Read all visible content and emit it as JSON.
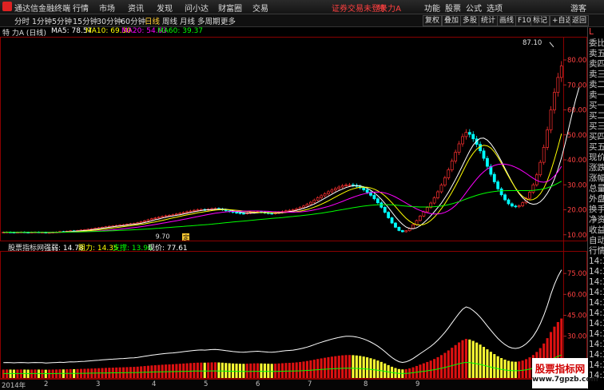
{
  "app": {
    "name": "通达信金融终端"
  },
  "menubar": {
    "items": [
      "行情",
      "市场",
      "资讯",
      "发现",
      "问小达",
      "财富圈",
      "交易"
    ],
    "status": "证券交易未登录",
    "stock_short": "特 力A",
    "right_items": [
      "功能",
      "股票",
      "公式",
      "选项",
      "游客"
    ]
  },
  "toolbar": {
    "timeframes": [
      "分时",
      "1分钟",
      "5分钟",
      "15分钟",
      "30分钟",
      "60分钟",
      "日线",
      "周线",
      "月线",
      "多周期",
      "更多"
    ],
    "active": "日线",
    "buttons": [
      "复权",
      "叠加",
      "多股",
      "统计",
      "画线",
      "F10",
      "标记",
      "+自选",
      "返回"
    ]
  },
  "stock": {
    "title": "特 力A (日线)",
    "ma": [
      {
        "label": "MA5: 78.57",
        "color": "#ffffff"
      },
      {
        "label": "MA10: 69.30",
        "color": "#ffff00"
      },
      {
        "label": "MA20: 54.63",
        "color": "#ff00ff"
      },
      {
        "label": "MA60: 39.37",
        "color": "#00ff00"
      }
    ]
  },
  "indicator": {
    "name": "股票指标网",
    "items": [
      {
        "label": "强弱: 14.78",
        "color": "#ffffff"
      },
      {
        "label": "阻力: 14.35",
        "color": "#ffff00"
      },
      {
        "label": "支撑: 13.96",
        "color": "#00ff00"
      },
      {
        "label": "现价: 77.61",
        "color": "#ffffff"
      }
    ]
  },
  "price_axis": {
    "ticks": [
      "80.00",
      "70.00",
      "60.00",
      "50.00",
      "40.00",
      "30.00",
      "20.00",
      "10.00"
    ],
    "high_label": "87.10",
    "low_label": "9.70",
    "marker": "定"
  },
  "ind_axis": {
    "ticks": [
      "75.00",
      "60.00",
      "45.00",
      "30.00"
    ]
  },
  "side_panel": {
    "top": "L",
    "items": [
      "委比",
      "卖五",
      "卖四",
      "卖三",
      "卖二",
      "卖一",
      "买一",
      "买二",
      "买三",
      "买四",
      "买五",
      "现价",
      "涨跌",
      "涨幅",
      "总量",
      "外盘",
      "换手",
      "净资",
      "收益",
      "自动",
      "行情",
      "14:34",
      "14:35",
      "14:35",
      "14:35",
      "14:35",
      "14:35",
      "14:35",
      "14:35",
      "14:35",
      "14:35",
      "14:35",
      "14:35"
    ]
  },
  "time_axis": {
    "labels": [
      "2014年",
      "2",
      "3",
      "4",
      "5",
      "6",
      "7",
      "8",
      "9"
    ]
  },
  "watermark": {
    "line1": "股票指标网",
    "line2": "www.7gpzb.com"
  },
  "colors": {
    "up": "#ff3030",
    "down": "#00ffff",
    "ma5": "#ffffff",
    "ma10": "#ffff00",
    "ma20": "#ff00ff",
    "ma60": "#00ff00",
    "border": "#8a0000"
  },
  "chart_data": {
    "type": "candlestick",
    "price_ylim": [
      8,
      88
    ],
    "ind_ylim": [
      0,
      90
    ],
    "prices": [
      11.0,
      11.1,
      11.0,
      10.9,
      11.0,
      11.1,
      11.0,
      10.9,
      11.0,
      11.1,
      11.0,
      11.0,
      10.8,
      10.9,
      11.0,
      11.1,
      11.3,
      11.2,
      11.4,
      11.6,
      11.5,
      11.7,
      11.9,
      12.0,
      12.2,
      12.4,
      12.6,
      12.8,
      13.0,
      13.2,
      13.4,
      13.5,
      13.7,
      13.9,
      14.0,
      14.2,
      14.4,
      14.5,
      14.8,
      15.2,
      15.6,
      16.0,
      16.4,
      16.7,
      17.0,
      17.3,
      17.6,
      17.8,
      18.0,
      18.3,
      18.6,
      18.9,
      19.2,
      19.5,
      19.8,
      20.0,
      20.1,
      20.0,
      20.2,
      20.4,
      20.5,
      20.3,
      20.0,
      19.6,
      19.3,
      19.0,
      18.8,
      18.6,
      18.5,
      18.7,
      18.9,
      19.1,
      19.2,
      19.0,
      18.8,
      18.6,
      18.5,
      18.7,
      19.0,
      19.3,
      19.6,
      19.8,
      20.0,
      20.4,
      20.9,
      21.5,
      22.2,
      23.0,
      23.9,
      24.8,
      25.6,
      26.4,
      27.2,
      27.9,
      28.5,
      29.1,
      29.6,
      29.9,
      30.0,
      29.8,
      29.4,
      28.8,
      28.0,
      27.0,
      25.8,
      24.4,
      22.8,
      21.0,
      19.0,
      16.8,
      14.7,
      13.0,
      11.7,
      11.2,
      11.6,
      12.6,
      14.0,
      15.7,
      17.5,
      19.2,
      20.9,
      22.7,
      24.8,
      27.2,
      29.9,
      32.8,
      36.0,
      39.5,
      43.0,
      46.4,
      49.3,
      51.0,
      50.2,
      48.4,
      46.2,
      43.6,
      40.6,
      37.4,
      34.2,
      31.2,
      28.4,
      26.0,
      24.0,
      22.4,
      21.5,
      21.2,
      21.6,
      22.8,
      24.6,
      27.0,
      30.0,
      34.0,
      39.0,
      45.0,
      52.0,
      60.0,
      67.0,
      73.0,
      77.6
    ],
    "high_value": 87.1,
    "low_value": 9.7,
    "ma5": [
      11.0,
      11.0,
      11.0,
      11.0,
      11.0,
      11.0,
      11.0,
      11.0,
      11.0,
      11.0,
      11.0,
      11.0,
      10.9,
      10.9,
      10.9,
      11.0,
      11.0,
      11.1,
      11.2,
      11.3,
      11.4,
      11.5,
      11.6,
      11.7,
      11.8,
      12.0,
      12.2,
      12.4,
      12.6,
      12.8,
      13.0,
      13.2,
      13.4,
      13.5,
      13.7,
      13.9,
      14.1,
      14.2,
      14.4,
      14.6,
      14.9,
      15.2,
      15.6,
      16.0,
      16.3,
      16.7,
      17.0,
      17.3,
      17.5,
      17.8,
      18.0,
      18.3,
      18.6,
      18.9,
      19.2,
      19.5,
      19.7,
      19.9,
      20.0,
      20.1,
      20.2,
      20.3,
      20.3,
      20.2,
      20.0,
      19.6,
      19.3,
      19.1,
      18.9,
      18.7,
      18.7,
      18.7,
      18.8,
      18.9,
      19.0,
      18.9,
      18.8,
      18.7,
      18.7,
      18.8,
      19.0,
      19.3,
      19.5,
      19.8,
      20.2,
      20.6,
      21.1,
      21.7,
      22.3,
      23.0,
      23.8,
      24.6,
      25.4,
      26.2,
      27.0,
      27.7,
      28.3,
      28.9,
      29.3,
      29.6,
      29.7,
      29.6,
      29.2,
      28.6,
      27.8,
      26.8,
      25.6,
      24.2,
      22.6,
      20.9,
      19.0,
      17.2,
      15.6,
      14.2,
      13.1,
      12.5,
      12.4,
      12.8,
      13.6,
      14.8,
      16.1,
      17.6,
      19.2,
      20.9,
      22.7,
      24.8,
      27.0,
      29.5,
      32.1,
      34.9,
      37.8,
      40.7,
      43.5,
      45.9,
      47.6,
      48.6,
      48.7,
      47.9,
      46.4,
      44.4,
      42.0,
      39.4,
      36.6,
      33.8,
      31.1,
      28.6,
      26.5,
      24.8,
      23.5,
      22.6,
      22.2,
      22.4,
      23.2,
      24.6,
      26.6,
      29.1,
      32.3,
      36.2,
      40.9,
      46.3,
      52.3,
      58.4,
      64.1,
      69.0
    ]
  }
}
